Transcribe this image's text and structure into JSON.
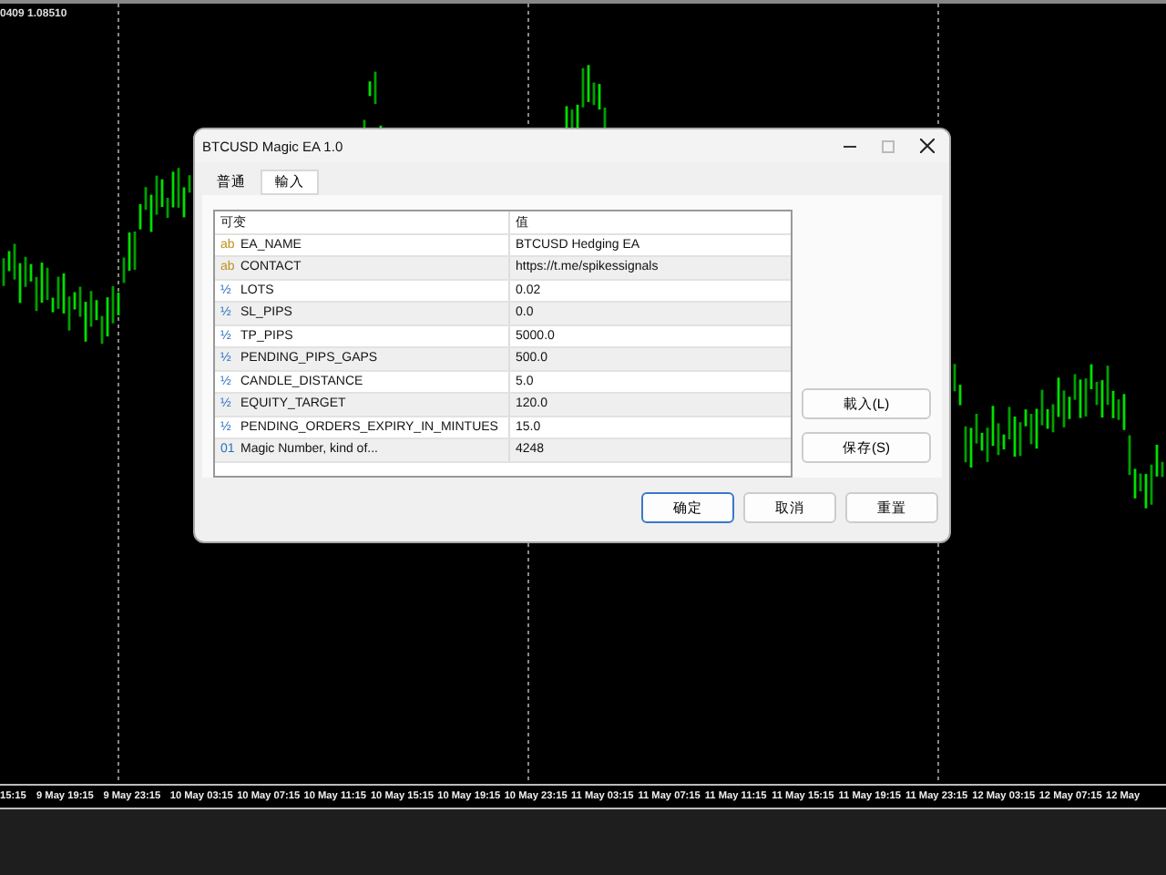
{
  "chart": {
    "price_label": "0409 1.08510",
    "time_axis": [
      "15:15",
      "9 May 19:15",
      "9 May 23:15",
      "10 May 03:15",
      "10 May 07:15",
      "10 May 11:15",
      "10 May 15:15",
      "10 May 19:15",
      "10 May 23:15",
      "11 May 03:15",
      "11 May 07:15",
      "11 May 11:15",
      "11 May 15:15",
      "11 May 19:15",
      "11 May 23:15",
      "12 May 03:15",
      "12 May 07:15",
      "12 May"
    ]
  },
  "dialog": {
    "title": "BTCUSD Magic EA 1.0",
    "tabs": [
      {
        "label": "普通",
        "selected": false
      },
      {
        "label": "輸入",
        "selected": true
      }
    ],
    "table": {
      "columns": [
        "可变",
        "值"
      ],
      "rows": [
        {
          "kind": "string",
          "icon": "ab",
          "name": "EA_NAME",
          "value": "BTCUSD Hedging EA"
        },
        {
          "kind": "string",
          "icon": "ab",
          "name": "CONTACT",
          "value": "https://t.me/spikessignals"
        },
        {
          "kind": "double",
          "icon": "½",
          "name": "LOTS",
          "value": "0.02"
        },
        {
          "kind": "double",
          "icon": "½",
          "name": "SL_PIPS",
          "value": "0.0"
        },
        {
          "kind": "double",
          "icon": "½",
          "name": "TP_PIPS",
          "value": "5000.0"
        },
        {
          "kind": "double",
          "icon": "½",
          "name": "PENDING_PIPS_GAPS",
          "value": "500.0"
        },
        {
          "kind": "double",
          "icon": "½",
          "name": "CANDLE_DISTANCE",
          "value": "5.0"
        },
        {
          "kind": "double",
          "icon": "½",
          "name": "EQUITY_TARGET",
          "value": "120.0"
        },
        {
          "kind": "double",
          "icon": "½",
          "name": "PENDING_ORDERS_EXPIRY_IN_MINTUES",
          "value": "15.0"
        },
        {
          "kind": "integer",
          "icon": "01",
          "name": "Magic Number, kind of...",
          "value": "4248"
        }
      ]
    },
    "side_buttons": [
      "載入(L)",
      "保存(S)"
    ],
    "buttons": [
      {
        "label": "确定",
        "default": true
      },
      {
        "label": "取消",
        "default": false
      },
      {
        "label": "重置",
        "default": false
      }
    ]
  }
}
